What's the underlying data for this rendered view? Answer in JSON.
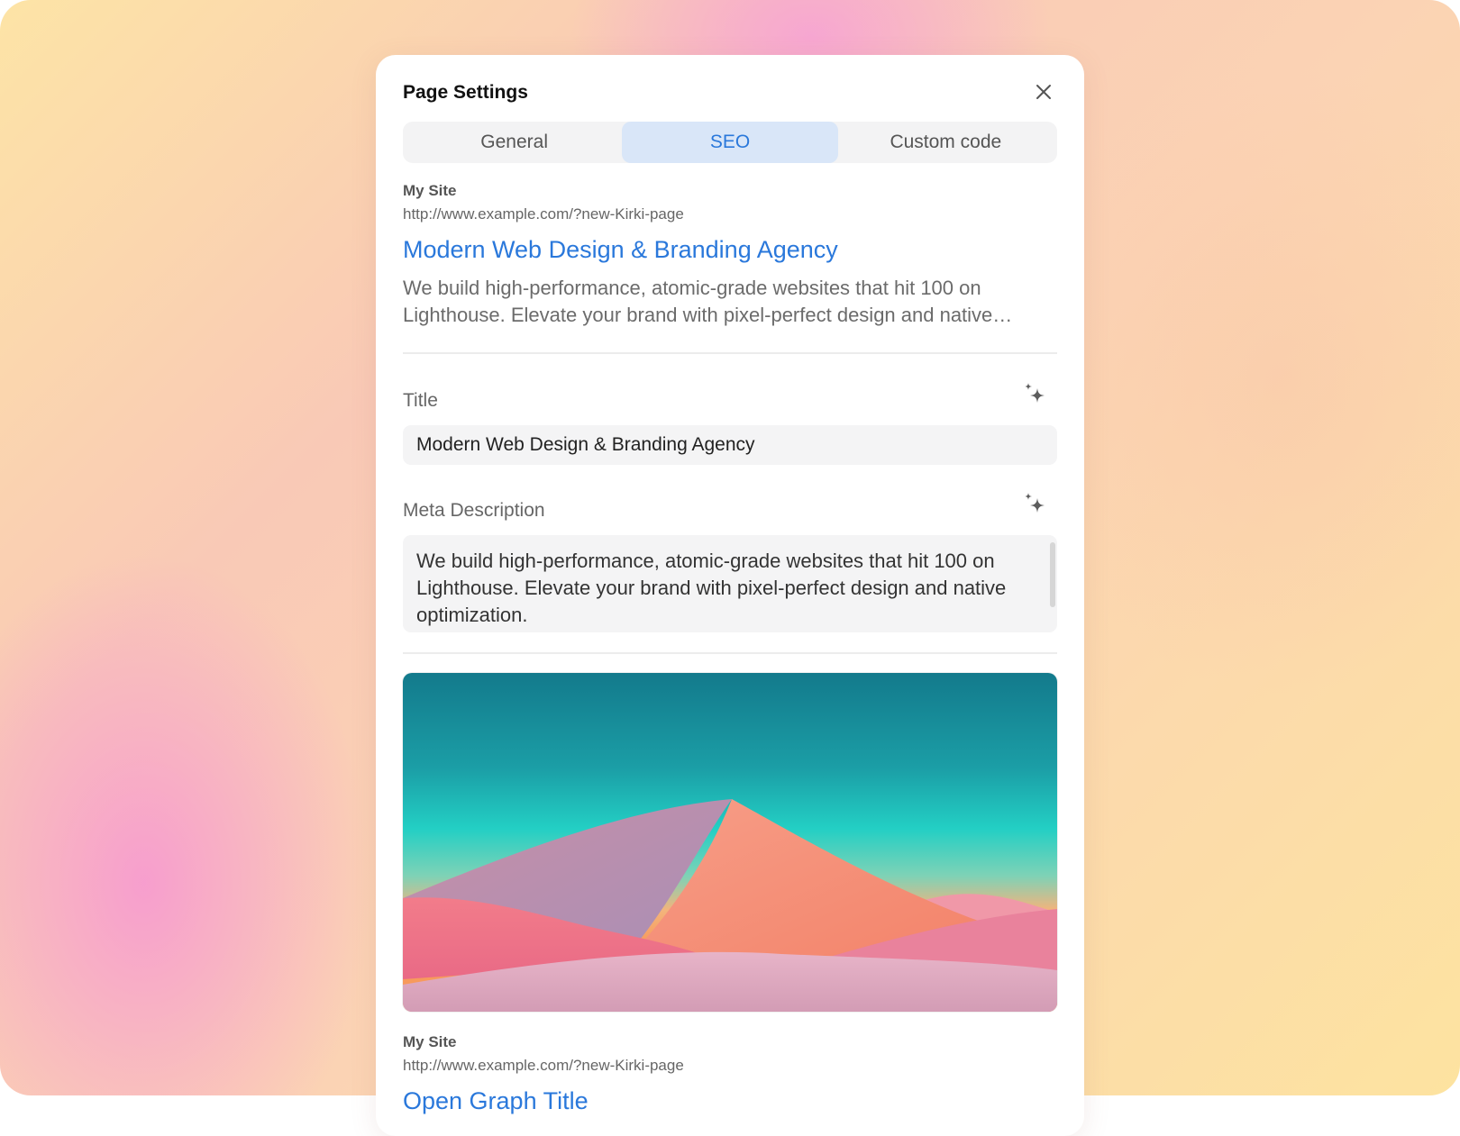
{
  "panel": {
    "title": "Page Settings"
  },
  "tabs": [
    {
      "label": "General",
      "active": false
    },
    {
      "label": "SEO",
      "active": true
    },
    {
      "label": "Custom code",
      "active": false
    }
  ],
  "search_preview": {
    "site_name": "My Site",
    "url": "http://www.example.com/?new-Kirki-page",
    "title": "Modern Web Design & Branding Agency",
    "description": "We build high-performance, atomic-grade websites that hit 100 on Lighthouse. Elevate your brand with pixel-perfect design and native optimization."
  },
  "fields": {
    "title_label": "Title",
    "title_value": "Modern Web Design & Branding Agency",
    "meta_label": "Meta Description",
    "meta_value": "We build high-performance, atomic-grade websites that hit 100 on Lighthouse. Elevate your brand with pixel-perfect design and native optimization."
  },
  "social_preview": {
    "site_name": "My Site",
    "url": "http://www.example.com/?new-Kirki-page",
    "title_partial": "Open Graph Title"
  },
  "colors": {
    "accent": "#2a78db",
    "tab_active_bg": "#d9e6f8",
    "panel_bg": "#ffffff"
  },
  "icons": {
    "close": "close-icon",
    "ai_generate": "sparkle-icon"
  }
}
